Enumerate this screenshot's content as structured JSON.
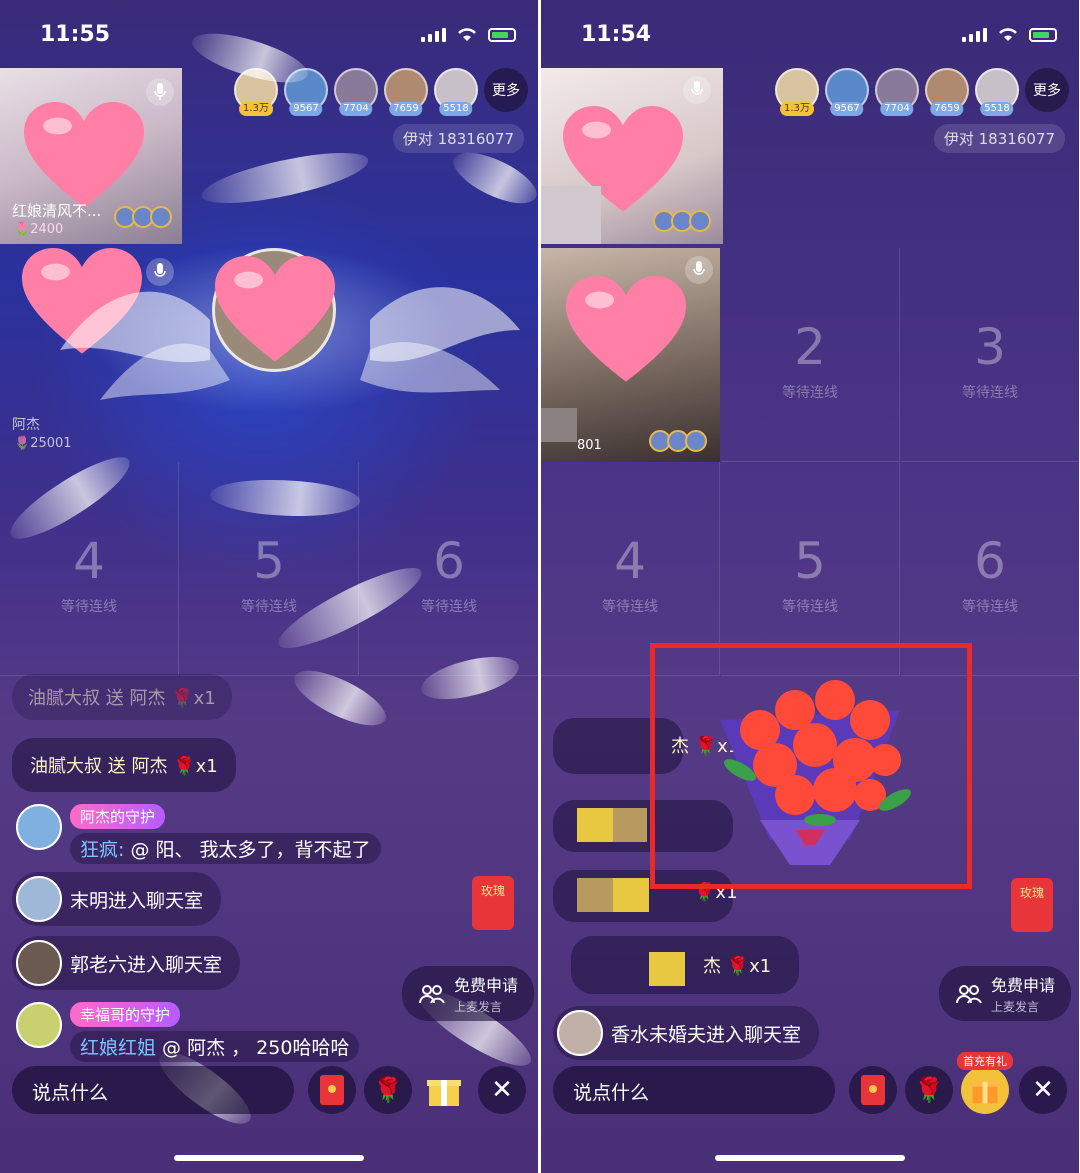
{
  "left": {
    "status_time": "11:55",
    "viewers": [
      {
        "badge": "1.3万",
        "gold": true
      },
      {
        "badge": "9567",
        "gold": false
      },
      {
        "badge": "7704",
        "gold": false
      },
      {
        "badge": "7659",
        "gold": false
      },
      {
        "badge": "5518",
        "gold": false
      }
    ],
    "more_label": "更多",
    "room_id": "伊对 18316077",
    "host_name": "红娘清风不...",
    "host_score": "2400",
    "guest_name": "阿杰",
    "guest_score": "25001",
    "seats": [
      {
        "num": "4",
        "wait": "等待连线"
      },
      {
        "num": "5",
        "wait": "等待连线"
      },
      {
        "num": "6",
        "wait": "等待连线"
      }
    ],
    "chat_faded": "油腻大叔 送 阿杰 🌹x1",
    "chat_gift": "油腻大叔 送 阿杰 🌹x1",
    "guard1_tag": "阿杰的守护",
    "guard1_who": "狂疯:",
    "guard1_msg": " @ 阳、 我太多了，背不起了",
    "join1": "末明进入聊天室",
    "join2": "郭老六进入聊天室",
    "guard2_tag": "幸福哥的守护",
    "guard2_who": "红娘红姐",
    "guard2_msg": " @ 阿杰 ， 250哈哈哈",
    "redpack_label": "玫瑰",
    "apply_title": "免费申请",
    "apply_sub": "上麦发言",
    "input_placeholder": "说点什么",
    "rose_glyph": "🌹"
  },
  "right": {
    "status_time": "11:54",
    "viewers": [
      {
        "badge": "1.3万",
        "gold": true
      },
      {
        "badge": "9567",
        "gold": false
      },
      {
        "badge": "7704",
        "gold": false
      },
      {
        "badge": "7659",
        "gold": false
      },
      {
        "badge": "5518",
        "gold": false
      }
    ],
    "more_label": "更多",
    "room_id": "伊对 18316077",
    "guest_score": "801",
    "seats": [
      {
        "num": "2",
        "wait": "等待连线"
      },
      {
        "num": "3",
        "wait": "等待连线"
      },
      {
        "num": "4",
        "wait": "等待连线"
      },
      {
        "num": "5",
        "wait": "等待连线"
      },
      {
        "num": "6",
        "wait": "等待连线"
      }
    ],
    "chat1": "杰 🌹x1",
    "chat2": "🌹x1",
    "chat3": "杰 🌹x1",
    "join": "香水未婚夫进入聊天室",
    "redpack_label": "玫瑰",
    "apply_title": "免费申请",
    "apply_sub": "上麦发言",
    "input_placeholder": "说点什么",
    "first_recharge": "首充有礼",
    "rose_glyph": "🌹"
  },
  "colors": {
    "highlight": "#e82a2a",
    "heart": "#ff7fa6",
    "background": "#4a3486"
  }
}
